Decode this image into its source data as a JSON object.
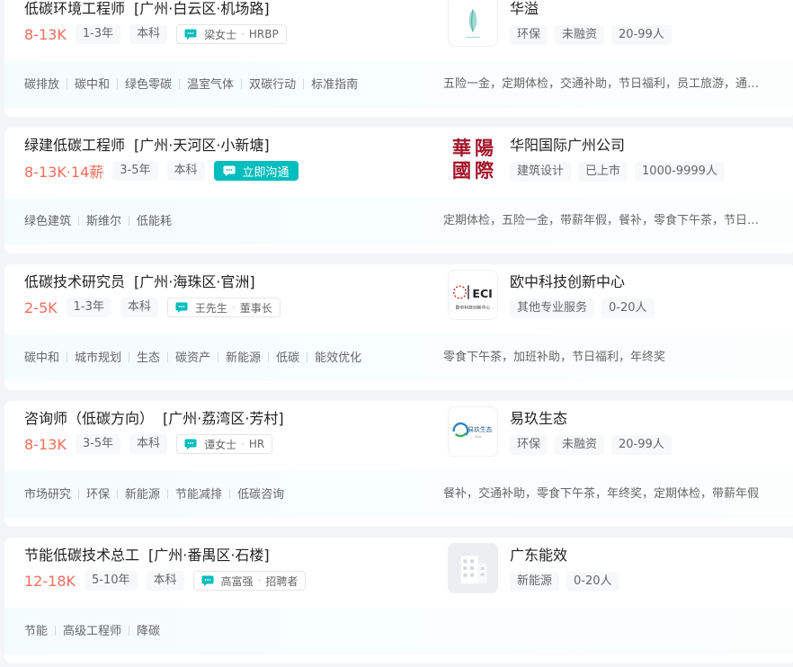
{
  "jobs": [
    {
      "title": "低碳环境工程师",
      "location": "[广州·白云区·机场路]",
      "salary": "8-13K",
      "experience": "1-3年",
      "education": "本科",
      "contact": {
        "type": "person",
        "name": "梁女士",
        "role": "HRBP"
      },
      "skills": [
        "碳排放",
        "碳中和",
        "绿色零碳",
        "温室气体",
        "双碳行动",
        "标准指南"
      ],
      "company": {
        "name": "华溢",
        "logo": "huayi-leaf-logo",
        "tags": [
          "环保",
          "未融资",
          "20-99人"
        ]
      },
      "welfare": "五险一金，定期体检，交通补助，节日福利，员工旅游，通讯补贴"
    },
    {
      "title": "绿建低碳工程师",
      "location": "[广州·天河区·小新塘]",
      "salary": "8-13K·14薪",
      "experience": "3-5年",
      "education": "本科",
      "contact": {
        "type": "chat",
        "label": "立即沟通"
      },
      "skills": [
        "绿色建筑",
        "斯维尔",
        "低能耗"
      ],
      "company": {
        "name": "华阳国际广州公司",
        "logo": "huayang-logo",
        "logo_text": [
          "華",
          "陽",
          "國",
          "際"
        ],
        "tags": [
          "建筑设计",
          "已上市",
          "1000-9999人"
        ]
      },
      "welfare": "定期体检，五险一金，带薪年假，餐补，零食下午茶，节日福利"
    },
    {
      "title": "低碳技术研究员",
      "location": "[广州·海珠区·官洲]",
      "salary": "2-5K",
      "experience": "1-3年",
      "education": "本科",
      "contact": {
        "type": "person",
        "name": "王先生",
        "role": "董事长"
      },
      "skills": [
        "碳中和",
        "城市规划",
        "生态",
        "碳资产",
        "新能源",
        "低碳",
        "能效优化"
      ],
      "company": {
        "name": "欧中科技创新中心",
        "logo": "eci-logo",
        "logo_text": [
          "ECI",
          "欧中科技创新中心"
        ],
        "tags": [
          "其他专业服务",
          "0-20人"
        ]
      },
      "welfare": "零食下午茶，加班补助，节日福利，年终奖"
    },
    {
      "title": "咨询师（低碳方向）",
      "location": "[广州·荔湾区·芳村]",
      "salary": "8-13K",
      "experience": "3-5年",
      "education": "本科",
      "contact": {
        "type": "person",
        "name": "谭女士",
        "role": "HR"
      },
      "skills": [
        "市场研究",
        "环保",
        "新能源",
        "节能减排",
        "低碳咨询"
      ],
      "company": {
        "name": "易玖生态",
        "logo": "yijiu-logo",
        "logo_text": [
          "易玖生态",
          "Eco"
        ],
        "tags": [
          "环保",
          "未融资",
          "20-99人"
        ]
      },
      "welfare": "餐补，交通补助，零食下午茶，年终奖，定期体检，带薪年假"
    },
    {
      "title": "节能低碳技术总工",
      "location": "[广州·番禺区·石楼]",
      "salary": "12-18K",
      "experience": "5-10年",
      "education": "本科",
      "contact": {
        "type": "person",
        "name": "高富强",
        "role": "招聘者"
      },
      "skills": [
        "节能",
        "高级工程师",
        "降碳"
      ],
      "company": {
        "name": "广东能效",
        "logo": "building-placeholder-icon",
        "tags": [
          "新能源",
          "0-20人"
        ]
      },
      "welfare": ""
    }
  ],
  "colors": {
    "salary": "#f26d5b",
    "chat_button": "#00bebd",
    "page_bg": "#f4f5f7",
    "card_bottom_bg": "#f5fcfc",
    "huayang_red": "#a3162a"
  }
}
